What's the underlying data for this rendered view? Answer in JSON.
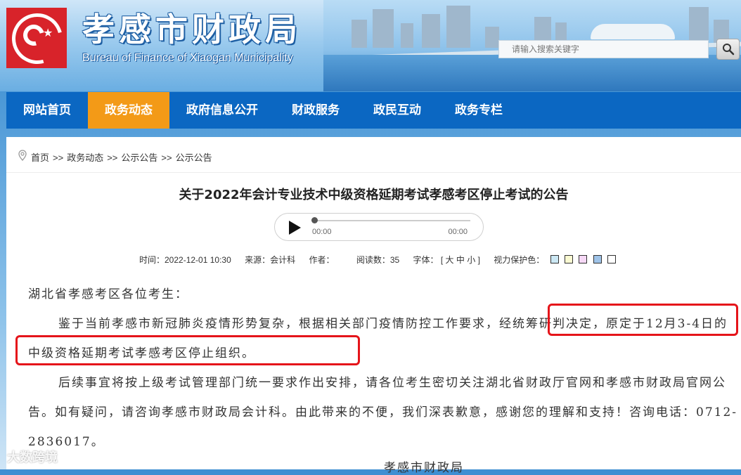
{
  "header": {
    "title": "孝感市财政局",
    "subtitle": "Bureau of Finance of Xiaogan Municipality",
    "search_placeholder": "请输入搜索关键字",
    "search_icon": "magnifier-icon",
    "colors": {
      "brand_red": "#d8232a",
      "nav_blue": "#0b67c2",
      "nav_active": "#f39a17"
    }
  },
  "nav": {
    "items": [
      {
        "label": "网站首页"
      },
      {
        "label": "政务动态",
        "active": true
      },
      {
        "label": "政府信息公开"
      },
      {
        "label": "财政服务"
      },
      {
        "label": "政民互动"
      },
      {
        "label": "政务专栏"
      }
    ]
  },
  "breadcrumb": {
    "icon": "location-pin-icon",
    "items": [
      "首页",
      "政务动态",
      "公示公告",
      "公示公告"
    ],
    "separator": ">>"
  },
  "article": {
    "title": "关于2022年会计专业技术中级资格延期考试孝感考区停止考试的公告",
    "player": {
      "current_time": "00:00",
      "duration": "00:00",
      "progress": 0
    },
    "meta": {
      "time": "时间：2022-12-01 10:30",
      "source": "来源：会计科",
      "author": "作者：",
      "views": "阅读数：35",
      "font_label": "字体：",
      "font_sizes": [
        "[ 大",
        "中",
        "小 ]"
      ],
      "eye_label": "视力保护色：",
      "eye_colors": [
        "#cce8f4",
        "#fafad2",
        "#f6d8f6",
        "#9fc3e8",
        "#ffffff"
      ]
    },
    "salutation": "湖北省孝感考区各位考生：",
    "paragraphs": [
      "鉴于当前孝感市新冠肺炎疫情形势复杂，根据相关部门疫情防控工作要求，经统筹研判决定，原定于12月3-4日的中级资格延期考试孝感考区停止组织。",
      "后续事宜将按上级考试管理部门统一要求作出安排，请各位考生密切关注湖北省财政厅官网和孝感市财政局官网公告。如有疑问，请咨询孝感市财政局会计科。由此带来的不便，我们深表歉意，感谢您的理解和支持！咨询电话：0712-2836017。"
    ],
    "signature": "孝感市财政局"
  },
  "watermark": "大数跨境"
}
